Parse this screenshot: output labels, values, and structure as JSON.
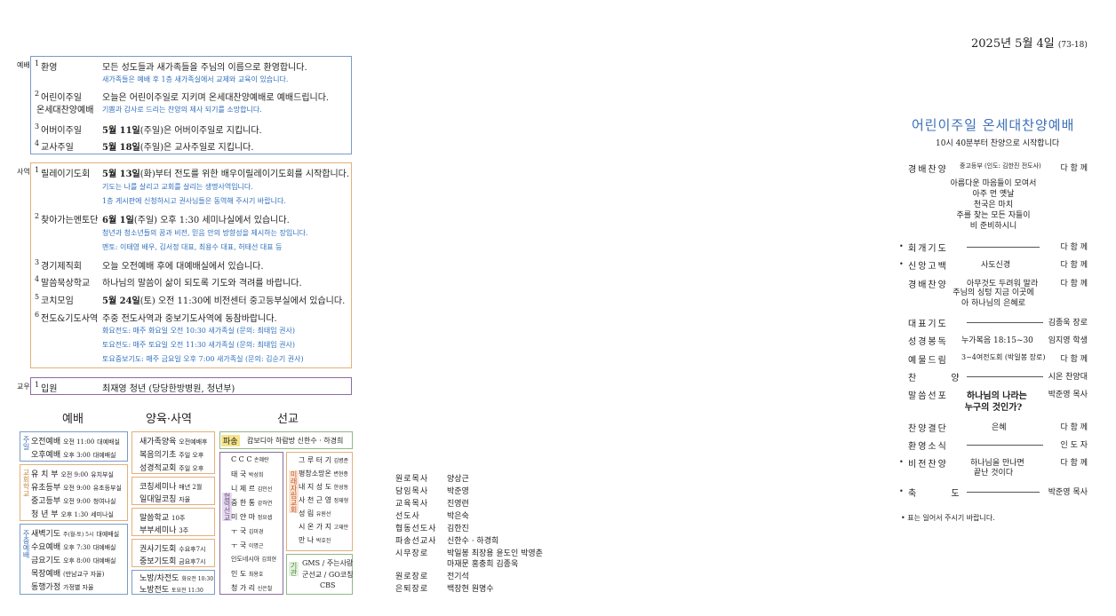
{
  "date": {
    "main": "2025년 5월 4일",
    "issue": "(73-18)"
  },
  "sections": {
    "worship_label": "예배",
    "mission_label": "사역",
    "fellowship_label": "교우"
  },
  "worship_items": [
    {
      "num": "1",
      "title": "환영",
      "desc": "모든 성도들과 새가족들을 주님의 이름으로 환영합니다.",
      "sub": [
        "새가족들은 예배 후 1층 새가족실에서 교제와 교육이 있습니다."
      ]
    },
    {
      "num": "2",
      "title": "어린이주일",
      "title2": "온세대찬양예배",
      "desc": "오늘은 어린이주일로 지키며 온세대찬양예배로 예배드립니다.",
      "sub": [
        "기쁨과 감사로 드리는 찬양의 제사 되기를 소망합니다."
      ]
    },
    {
      "num": "3",
      "title": "어버이주일",
      "desc_bold": "5월 11일",
      "desc_rest": "(주일)은 어버이주일로 지킵니다."
    },
    {
      "num": "4",
      "title": "교사주일",
      "desc_bold": "5월 18일",
      "desc_rest": "(주일)은 교사주일로 지킵니다."
    }
  ],
  "mission_items": [
    {
      "num": "1",
      "title": "릴레이기도회",
      "desc_bold": "5월 13일",
      "desc_rest": "(화)부터 전도를 위한 배우이릴레이기도회를 시작합니다.",
      "sub": [
        "기도는 나를 살리고 교회를 살리는 생명사역입니다.",
        "1층 게시판에 신청하시고 권사님들은 동역해 주시기 바랍니다."
      ]
    },
    {
      "num": "2",
      "title": "찾아가는멘토단",
      "desc_bold": "6월 1일",
      "desc_rest": "(주일) 오후 1:30 세미나실에서 있습니다.",
      "sub": [
        "청년과 청소년들의 꿈과 비전, 믿음 안의 방향성을 제시하는 장입니다.",
        "멘토: 이태영 배우, 김서정 대표, 최용수 대표, 허태선 대표 등"
      ]
    },
    {
      "num": "3",
      "title": "경기제직회",
      "desc": "오늘 오전예배 후에 대예배실에서 있습니다."
    },
    {
      "num": "4",
      "title": "말씀묵상학교",
      "desc": "하나님의 말씀이 삶이 되도록 기도와 격려를 바랍니다."
    },
    {
      "num": "5",
      "title": "코치모임",
      "desc_bold": "5월 24일",
      "desc_rest": "(토) 오전 11:30에 비전센터 중고등부실에서 있습니다."
    },
    {
      "num": "6",
      "title": "전도&기도사역",
      "desc": "주중 전도사역과 중보기도사역에 동참바랍니다.",
      "sub": [
        "화요전도: 매주 화요일 오전 10:30 새가족실 (문의: 최태임 권사)",
        "토요전도: 매주 토요일 오전 11:30 새가족실 (문의: 최태임 권사)",
        "토요중보기도: 매주 금요일 오후 7:00 새가족실 (문의: 김순기 권사)"
      ]
    }
  ],
  "fellowship_items": [
    {
      "num": "1",
      "title": "입원",
      "desc": "최재영 청년 (당당한방병원, 청년부)"
    }
  ],
  "schedule": {
    "worship_head": "예배",
    "nurture_head": "양육·사역",
    "missions_head": "선교",
    "sunday_label": "주일",
    "sunday": [
      {
        "name": "오전예배",
        "time": "오전 11:00",
        "place": "대예배실"
      },
      {
        "name": "오후예배",
        "time": "오후  3:00",
        "place": "대예배실"
      }
    ],
    "school_label": "교회학교",
    "school": [
      {
        "name": "유  치  부",
        "time": "오전  9:00",
        "place": "유치부실"
      },
      {
        "name": "유초등부",
        "time": "오전  9:00",
        "place": "유초등부실"
      },
      {
        "name": "중고등부",
        "time": "오전  9:00",
        "place": "청여나실"
      },
      {
        "name": "청  년  부",
        "time": "오후  1:30",
        "place": "세미나실"
      }
    ],
    "weekday_label": "주중예배",
    "weekday": [
      {
        "name": "새벽기도",
        "time": "주(월-토) 5시",
        "place": "대예배실"
      },
      {
        "name": "수요예배",
        "time": "오후  7:30",
        "place": "대예배실"
      },
      {
        "name": "금요기도",
        "time": "오후  8:00",
        "place": "대예배실"
      },
      {
        "name": "목장예배",
        "time": "(만남교구 자율)",
        "place": ""
      },
      {
        "name": "동행가정",
        "time": "가정별 자율",
        "place": ""
      }
    ],
    "nurture": [
      {
        "label": "새가족양육",
        "detail": "오전예배후"
      },
      {
        "label": "복음의기초",
        "detail": "주일 오후"
      },
      {
        "label": "성경적교회",
        "detail": "주일 오후"
      },
      {
        "label": "코칭세미나",
        "detail": "매년 2월"
      },
      {
        "label": "일대일코칭",
        "detail": "자율"
      },
      {
        "label": "말씀학교",
        "detail": "10주"
      },
      {
        "label": "부부세미나",
        "detail": "3주"
      },
      {
        "label": "권사기도회",
        "detail": "수요후7시"
      },
      {
        "label": "중보기도회",
        "detail": "금요후7시"
      },
      {
        "label": "노방/차전도",
        "detail": "화요전 10:30"
      },
      {
        "label": "노방전도",
        "detail": "토요전 11:30"
      }
    ],
    "dispatch_tag": "파송",
    "dispatch_line": "캄보디아 하람방   신한수 · 하경희",
    "missions_label": "협력선교",
    "missions_left": [
      {
        "name": "C C C",
        "person": "손혜란"
      },
      {
        "name": "태    국",
        "person": "박성희"
      },
      {
        "name": "니  제  르",
        "person": "김인선"
      },
      {
        "name": "중  한  통",
        "person": "강하연"
      },
      {
        "name": "미  얀  마",
        "person": "정요셉"
      },
      {
        "name": "ㅜ    국",
        "person": "김미경"
      },
      {
        "name": "ㅜ    국",
        "person": "이명근"
      },
      {
        "name": "인도네시아",
        "person": "김희현"
      },
      {
        "name": "인    도",
        "person": "최용호"
      },
      {
        "name": "청  가  리",
        "person": "신은철"
      }
    ],
    "church_label": "미래자립교회",
    "church_right": [
      {
        "name": "그 루 터 기",
        "person": "김병준"
      },
      {
        "name": "평창소망온",
        "person": "변현종"
      },
      {
        "name": "내 지 성 도",
        "person": "한성동"
      },
      {
        "name": "사 천 근 영",
        "person": "정재형"
      },
      {
        "name": "성    림",
        "person": "유원선"
      },
      {
        "name": "시 온 가 지",
        "person": "고재만"
      },
      {
        "name": "만    나",
        "person": "박호진"
      }
    ],
    "org_label": "기관",
    "org_lines": [
      "GMS / 주는사랑",
      "군선교 / GO코칭",
      "CBS"
    ]
  },
  "staff": [
    {
      "role": "원로목사",
      "names": "양상근"
    },
    {
      "role": "담임목사",
      "names": "박준영"
    },
    {
      "role": "교육목사",
      "names": "진영련"
    },
    {
      "role": "선도사",
      "names": "박은숙"
    },
    {
      "role": "협동선도사",
      "names": "김한진"
    },
    {
      "role": "파송선교사",
      "names": "신한수 · 하경희"
    },
    {
      "role": "시무장로",
      "names": "박일봉 최장용 윤도인 박영춘"
    },
    {
      "role": "",
      "names": "마재문 홍충희 김종욱"
    },
    {
      "role": "원로장로",
      "names": "전기석"
    },
    {
      "role": "은퇴장로",
      "names": "백장현 원명수"
    }
  ],
  "program": {
    "title": "어린이주일 온세대찬양예배",
    "subtitle": "10시 40분부터 찬양으로 시작합니다",
    "rows": [
      {
        "bullet": "",
        "label": "경배찬양",
        "mid": "중고등부 (인도: 김한진 전도사)",
        "right": "다 함 께",
        "line": false
      },
      {
        "bullet": "•",
        "label": "회개기도",
        "mid": "",
        "right": "다 함 께",
        "line": true
      },
      {
        "bullet": "•",
        "label": "신앙고백",
        "mid": "사도신경",
        "right": "다 함 께",
        "line": false
      },
      {
        "bullet": "",
        "label": "경배찬양",
        "mid": "아무것도 두려워 말라",
        "right": "다 함 께",
        "line": false
      },
      {
        "bullet": "",
        "label": "대표기도",
        "mid": "",
        "right": "김종욱 장로",
        "line": true
      },
      {
        "bullet": "",
        "label": "성경봉독",
        "mid": "누가복음 18:15~30",
        "right": "임지영 학생",
        "line": false
      },
      {
        "bullet": "",
        "label": "예물드림",
        "mid": "3~4여전도회 (박일봉 장로)",
        "right": "다 함 께",
        "line": false
      },
      {
        "bullet": "",
        "label": "찬  양",
        "mid": "",
        "right": "시온 찬양대",
        "line": true
      },
      {
        "bullet": "",
        "label": "말씀선포",
        "mid": "하나님의 나라는",
        "right": "박준영 목사",
        "line": false
      },
      {
        "bullet": "",
        "label": "찬양결단",
        "mid": "은혜",
        "right": "다 함 께",
        "line": false
      },
      {
        "bullet": "",
        "label": "환영소식",
        "mid": "",
        "right": "인 도 자",
        "line": true
      },
      {
        "bullet": "•",
        "label": "비전찬양",
        "mid": "하나님을 만나면",
        "right": "다 함 께",
        "line": false
      },
      {
        "bullet": "•",
        "label": "축  도",
        "mid": "",
        "right": "박준영 목사",
        "line": true
      }
    ],
    "lyric1": [
      "아름다운 마음들이 모여서",
      "아주 먼 옛날",
      "천국은 마치",
      "주를 찾는 모든 자들이",
      "비 준비하시니"
    ],
    "lyric2": [
      "주님의 싱텅 지금 이곳에",
      "아 하나님의 은혜로"
    ],
    "sermon_line2": "누구의 것인가?",
    "vision_line2": "끝난 것이다",
    "footnote": "• 표는 일어서 주시기 바랍니다.",
    "colors": {
      "title": "#3c6fb8"
    }
  }
}
